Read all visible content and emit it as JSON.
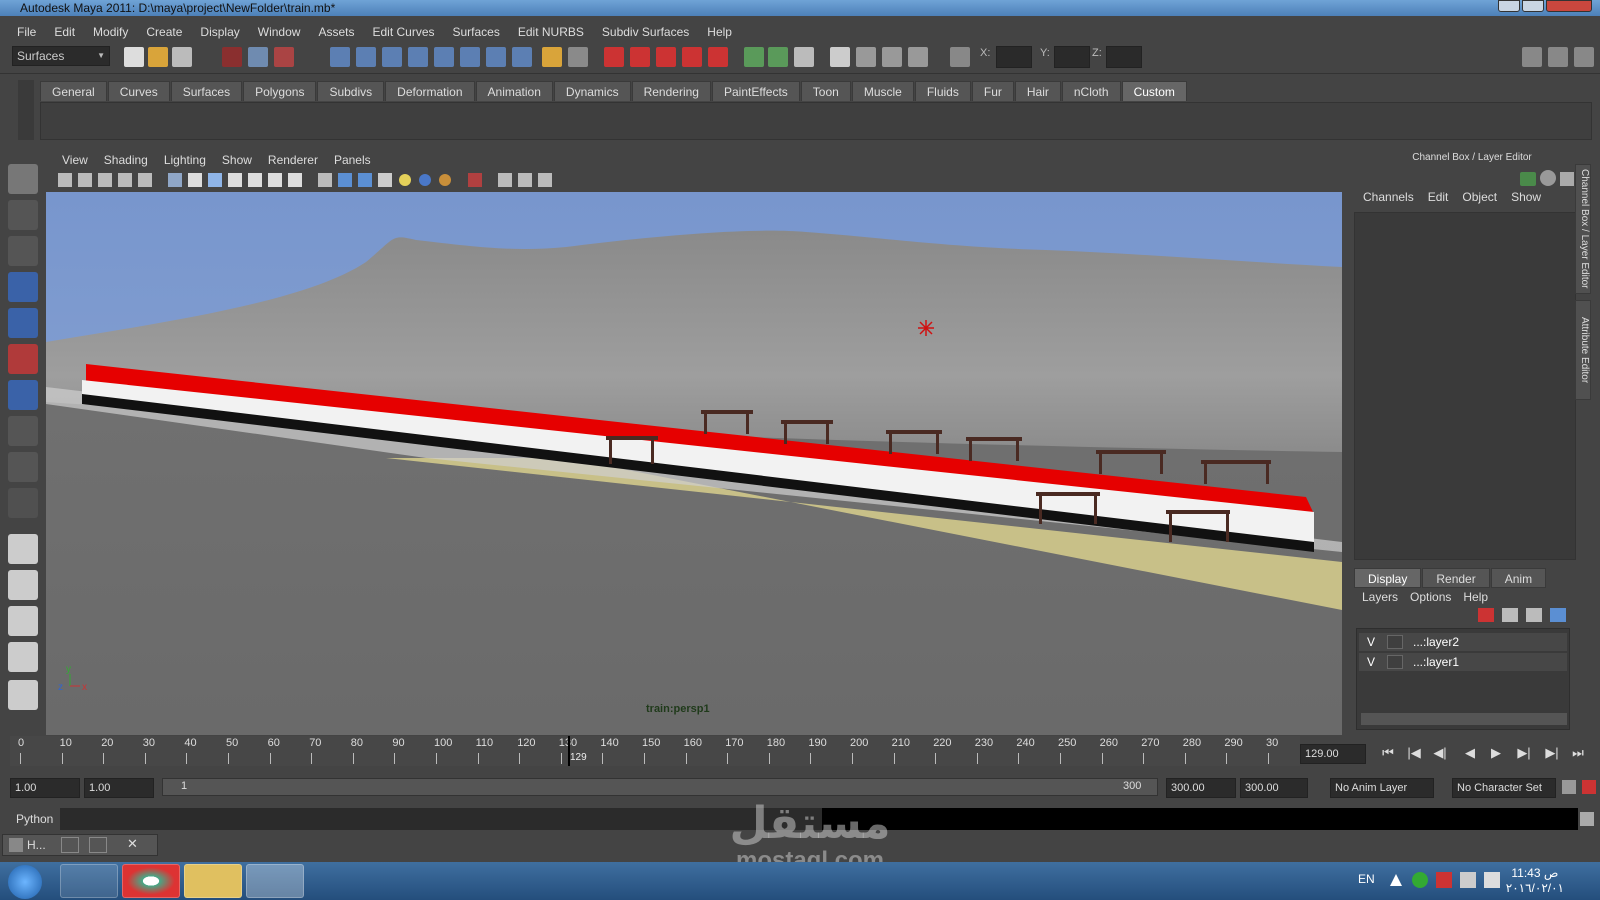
{
  "window": {
    "title": "Autodesk Maya 2011: D:\\maya\\project\\NewFolder\\train.mb*"
  },
  "menubar": [
    "File",
    "Edit",
    "Modify",
    "Create",
    "Display",
    "Window",
    "Assets",
    "Edit Curves",
    "Surfaces",
    "Edit NURBS",
    "Subdiv Surfaces",
    "Help"
  ],
  "statusline": {
    "mode": "Surfaces",
    "x_label": "X:",
    "y_label": "Y:",
    "z_label": "Z:"
  },
  "shelf": {
    "tabs": [
      "General",
      "Curves",
      "Surfaces",
      "Polygons",
      "Subdivs",
      "Deformation",
      "Animation",
      "Dynamics",
      "Rendering",
      "PaintEffects",
      "Toon",
      "Muscle",
      "Fluids",
      "Fur",
      "Hair",
      "nCloth",
      "Custom"
    ],
    "active": "Custom"
  },
  "viewport": {
    "menu": [
      "View",
      "Shading",
      "Lighting",
      "Show",
      "Renderer",
      "Panels"
    ],
    "camera": "train:persp1"
  },
  "channel_box": {
    "title": "Channel Box / Layer Editor",
    "menu": [
      "Channels",
      "Edit",
      "Object",
      "Show"
    ],
    "side_tabs": [
      "Channel Box / Layer Editor",
      "Attribute Editor"
    ]
  },
  "layer_editor": {
    "tabs": [
      "Display",
      "Render",
      "Anim"
    ],
    "active": "Display",
    "menu": [
      "Layers",
      "Options",
      "Help"
    ],
    "layers": [
      {
        "v": "V",
        "name": "...:layer2"
      },
      {
        "v": "V",
        "name": "...:layer1"
      }
    ]
  },
  "timeline": {
    "ticks": [
      "0",
      "10",
      "20",
      "30",
      "40",
      "50",
      "60",
      "70",
      "80",
      "90",
      "100",
      "110",
      "120",
      "130",
      "140",
      "150",
      "160",
      "170",
      "180",
      "190",
      "200",
      "210",
      "220",
      "230",
      "240",
      "250",
      "260",
      "270",
      "280",
      "290",
      "30"
    ],
    "current": "129",
    "current_field": "129.00"
  },
  "range": {
    "start1": "1.00",
    "start2": "1.00",
    "range_start": "1",
    "range_end": "300",
    "end1": "300.00",
    "end2": "300.00",
    "anim_layer": "No Anim Layer",
    "char_set": "No Character Set"
  },
  "commandline": {
    "label": "Python"
  },
  "minimized": {
    "label": "H..."
  },
  "taskbar": {
    "lang": "EN",
    "time": "11:43 ص",
    "date": "٢٠١٦/٠٢/٠١"
  },
  "watermark": {
    "arabic": "مستقل",
    "latin": "mostaql.com"
  },
  "colors": {
    "train_red": "#e60000",
    "sky": "#7a9bd0",
    "ground": "#6e6e6e",
    "track": "#c9c08a"
  }
}
